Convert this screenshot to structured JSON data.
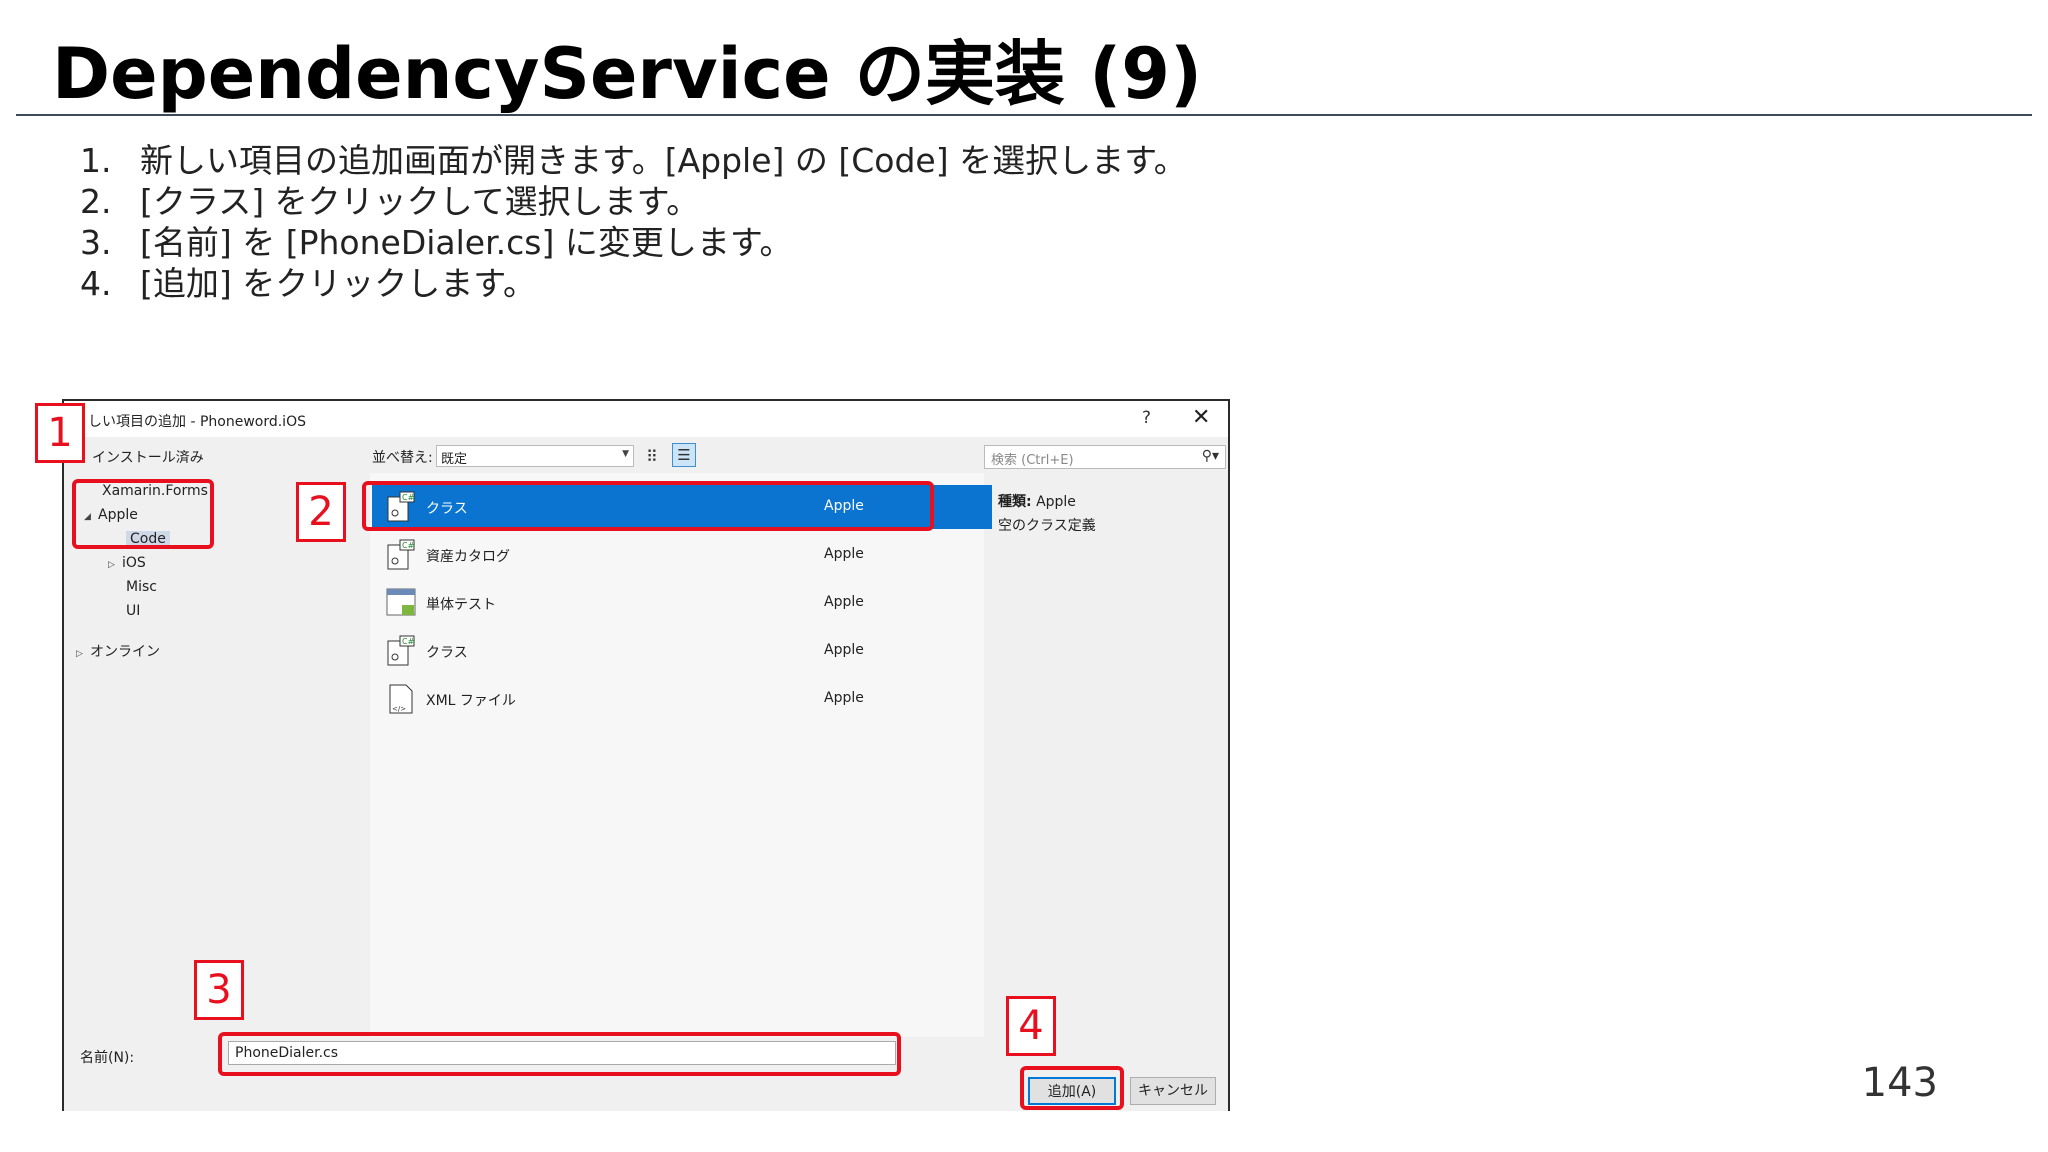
{
  "slide": {
    "title": "DependencyService の実装 (9)",
    "page_number": "143"
  },
  "steps": [
    {
      "num": "1.",
      "text": "新しい項目の追加画面が開きます。[Apple] の [Code] を選択します。"
    },
    {
      "num": "2.",
      "text": "[クラス] をクリックして選択します。"
    },
    {
      "num": "3.",
      "text": "[名前] を [PhoneDialer.cs] に変更します。"
    },
    {
      "num": "4.",
      "text": "[追加] をクリックします。"
    }
  ],
  "dialog": {
    "title": "しい項目の追加 - Phoneword.iOS",
    "help": "?",
    "close": "✕",
    "installed_header": "インストール済み",
    "tree": {
      "xamarin_forms": "Xamarin.Forms",
      "apple": "Apple",
      "code": "Code",
      "ios": "iOS",
      "misc": "Misc",
      "ui": "UI",
      "online": "オンライン"
    },
    "sort_label": "並べ替え:",
    "sort_value": "既定",
    "search_placeholder": "検索 (Ctrl+E)",
    "templates": [
      {
        "name": "クラス",
        "source": "Apple",
        "icon": "csharp-class-icon"
      },
      {
        "name": "資産カタログ",
        "source": "Apple",
        "icon": "asset-catalog-icon"
      },
      {
        "name": "単体テスト",
        "source": "Apple",
        "icon": "unit-test-icon"
      },
      {
        "name": "クラス",
        "source": "Apple",
        "icon": "csharp-class-icon"
      },
      {
        "name": "XML ファイル",
        "source": "Apple",
        "icon": "xml-file-icon"
      }
    ],
    "info_type_label": "種類:",
    "info_type_value": "Apple",
    "info_desc": "空のクラス定義",
    "name_label": "名前(N):",
    "name_value": "PhoneDialer.cs",
    "add_button": "追加(A)",
    "cancel_button": "キャンセル"
  },
  "markers": [
    "1",
    "2",
    "3",
    "4"
  ],
  "colors": {
    "highlight": "#e8101e",
    "selection": "#0a74d0",
    "title_rule": "#3b4a5a"
  }
}
